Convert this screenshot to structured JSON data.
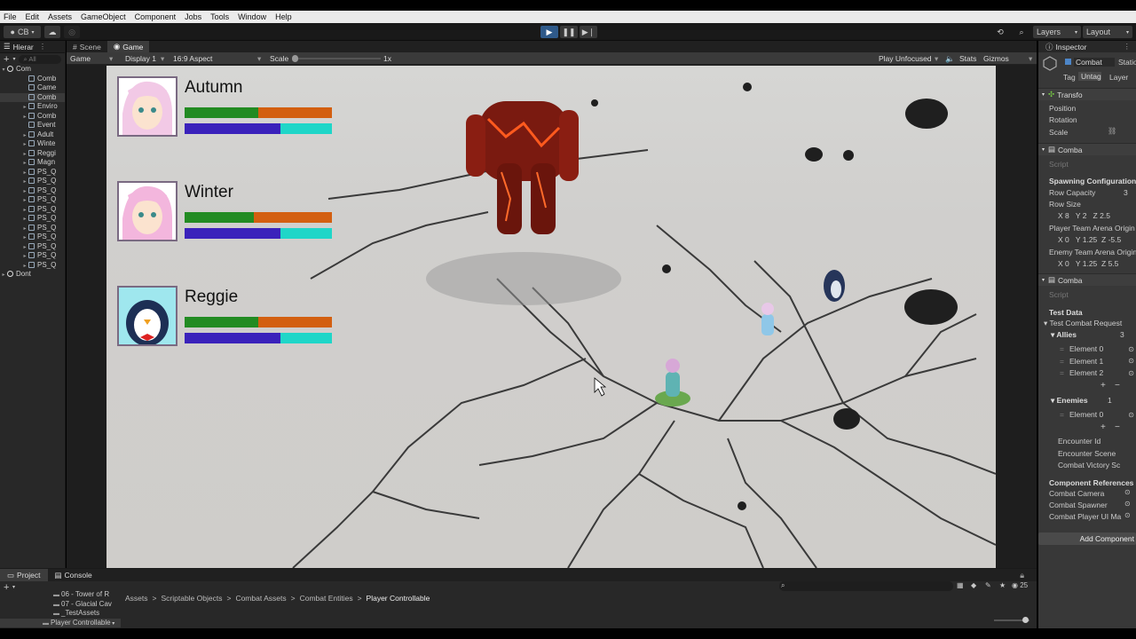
{
  "menu": [
    "File",
    "Edit",
    "Assets",
    "GameObject",
    "Component",
    "Jobs",
    "Tools",
    "Window",
    "Help"
  ],
  "toolbar": {
    "account": "CB",
    "layers": "Layers",
    "layout": "Layout"
  },
  "hierarchy": {
    "tab": "Hierar",
    "search": "All",
    "items": [
      {
        "label": "Com",
        "indent": 0,
        "arrow": "▾",
        "root": true
      },
      {
        "label": "Comb",
        "indent": 1,
        "arrow": ""
      },
      {
        "label": "Came",
        "indent": 1,
        "arrow": ""
      },
      {
        "label": "Comb",
        "indent": 1,
        "arrow": ""
      },
      {
        "label": "Enviro",
        "indent": 1,
        "arrow": "▸"
      },
      {
        "label": "Comb",
        "indent": 1,
        "arrow": "▸"
      },
      {
        "label": "Event",
        "indent": 1,
        "arrow": ""
      },
      {
        "label": "Adult",
        "indent": 1,
        "arrow": "▸"
      },
      {
        "label": "Winte",
        "indent": 1,
        "arrow": "▸"
      },
      {
        "label": "Reggi",
        "indent": 1,
        "arrow": "▸"
      },
      {
        "label": "Magn",
        "indent": 1,
        "arrow": "▸"
      },
      {
        "label": "PS_Q",
        "indent": 1,
        "arrow": "▸"
      },
      {
        "label": "PS_Q",
        "indent": 1,
        "arrow": "▸"
      },
      {
        "label": "PS_Q",
        "indent": 1,
        "arrow": "▸"
      },
      {
        "label": "PS_Q",
        "indent": 1,
        "arrow": "▸"
      },
      {
        "label": "PS_Q",
        "indent": 1,
        "arrow": "▸"
      },
      {
        "label": "PS_Q",
        "indent": 1,
        "arrow": "▸"
      },
      {
        "label": "PS_Q",
        "indent": 1,
        "arrow": "▸"
      },
      {
        "label": "PS_Q",
        "indent": 1,
        "arrow": "▸"
      },
      {
        "label": "PS_Q",
        "indent": 1,
        "arrow": "▸"
      },
      {
        "label": "PS_Q",
        "indent": 1,
        "arrow": "▸"
      },
      {
        "label": "PS_Q",
        "indent": 1,
        "arrow": "▸"
      },
      {
        "label": "Dont",
        "indent": 0,
        "arrow": "▸",
        "root": true
      }
    ]
  },
  "game": {
    "tabs": [
      "Scene",
      "Game"
    ],
    "mode": "Game",
    "display": "Display 1",
    "aspect": "16:9 Aspect",
    "scale_label": "Scale",
    "scale_value": "1x",
    "play_mode": "Play Unfocused",
    "stats": "Stats",
    "gizmos": "Gizmos"
  },
  "party": [
    {
      "name": "Autumn",
      "hp_fraction": 0.5,
      "mp_fraction": 0.65,
      "portrait": "autumn"
    },
    {
      "name": "Winter",
      "hp_fraction": 0.47,
      "mp_fraction": 0.65,
      "portrait": "winter"
    },
    {
      "name": "Reggie",
      "hp_fraction": 0.5,
      "mp_fraction": 0.65,
      "portrait": "penguin"
    }
  ],
  "colors": {
    "hp": "#228b22",
    "hp_back": "#d35f10",
    "mp": "#3a22bb",
    "mp_back": "#1fd6c8"
  },
  "inspector": {
    "tab": "Inspector",
    "object_name": "Combat",
    "static": "Statio",
    "tag_label": "Tag",
    "tag_value": "Untag",
    "layer_label": "Layer",
    "transform": "Transfo",
    "position": "Position",
    "rotation": "Rotation",
    "scale": "Scale",
    "comp1": "Comba",
    "script": "Script",
    "spawning": "Spawning Configuration",
    "row_capacity": "Row Capacity",
    "row_capacity_val": "3",
    "row_size": "Row Size",
    "row_size_x": "8",
    "row_size_y": "2",
    "row_size_z": "2.5",
    "player_origin": "Player Team Arena Origin",
    "po_x": "0",
    "po_y": "1.25",
    "po_z": "-5.5",
    "enemy_origin": "Enemy Team Arena Origin",
    "eo_x": "0",
    "eo_y": "1.25",
    "eo_z": "5.5",
    "comp2": "Comba",
    "script2": "Script",
    "test_data": "Test Data",
    "test_request": "Test Combat Request",
    "allies": "Allies",
    "allies_count": "3",
    "allies_elements": [
      "Element 0",
      "Element 1",
      "Element 2"
    ],
    "enemies": "Enemies",
    "enemies_count": "1",
    "enemies_elements": [
      "Element 0"
    ],
    "encounter_id": "Encounter Id",
    "encounter_scene": "Encounter Scene",
    "victory": "Combat Victory Sc",
    "comp_refs": "Component References",
    "ref1": "Combat Camera",
    "ref2": "Combat Spawner",
    "ref3": "Combat Player UI Ma",
    "add_component": "Add Component"
  },
  "bottom": {
    "tabs": [
      "Project",
      "Console"
    ],
    "folders": [
      "06 - Tower of R",
      "07 - Glacial Cav",
      "_TestAssets",
      "Player Controllable"
    ],
    "breadcrumb": [
      "Assets",
      "Scriptable Objects",
      "Combat Assets",
      "Combat Entities",
      "Player Controllable"
    ],
    "count": "25"
  }
}
